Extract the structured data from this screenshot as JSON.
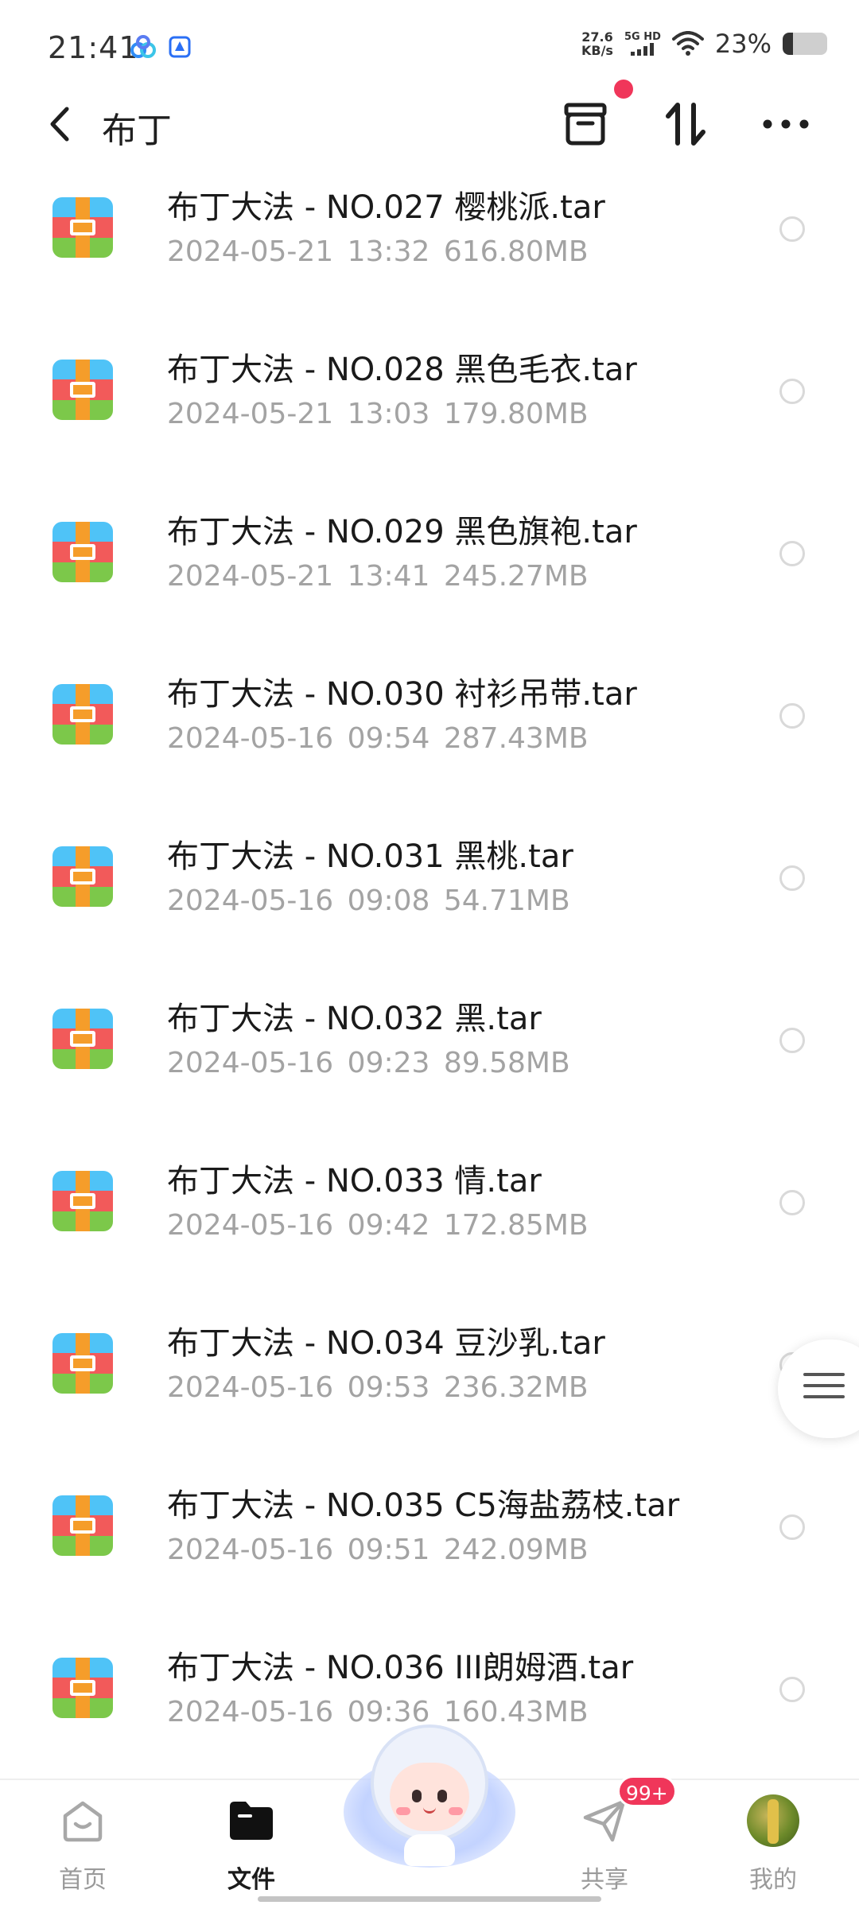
{
  "status_bar": {
    "time": "21:41",
    "net_speed_value": "27.6",
    "net_speed_unit": "KB/s",
    "network_label_top": "5G HD",
    "battery_percent": "23%",
    "battery_level": 0.23
  },
  "header": {
    "title": "布丁",
    "notification_dot": true
  },
  "files": [
    {
      "name": "布丁大法 - NO.027 樱桃派.tar",
      "date": "2024-05-21",
      "time": "13:32",
      "size": "616.80MB"
    },
    {
      "name": "布丁大法 - NO.028 黑色毛衣.tar",
      "date": "2024-05-21",
      "time": "13:03",
      "size": "179.80MB"
    },
    {
      "name": "布丁大法 - NO.029 黑色旗袍.tar",
      "date": "2024-05-21",
      "time": "13:41",
      "size": "245.27MB"
    },
    {
      "name": "布丁大法 - NO.030 衬衫吊带.tar",
      "date": "2024-05-16",
      "time": "09:54",
      "size": "287.43MB"
    },
    {
      "name": "布丁大法 - NO.031 黑桃.tar",
      "date": "2024-05-16",
      "time": "09:08",
      "size": "54.71MB"
    },
    {
      "name": "布丁大法 - NO.032 黑.tar",
      "date": "2024-05-16",
      "time": "09:23",
      "size": "89.58MB"
    },
    {
      "name": "布丁大法 - NO.033 情.tar",
      "date": "2024-05-16",
      "time": "09:42",
      "size": "172.85MB"
    },
    {
      "name": "布丁大法 - NO.034 豆沙乳.tar",
      "date": "2024-05-16",
      "time": "09:53",
      "size": "236.32MB"
    },
    {
      "name": "布丁大法 - NO.035 C5海盐荔枝.tar",
      "date": "2024-05-16",
      "time": "09:51",
      "size": "242.09MB"
    },
    {
      "name": "布丁大法 - NO.036 III朗姆酒.tar",
      "date": "2024-05-16",
      "time": "09:36",
      "size": "160.43MB"
    }
  ],
  "bottom_nav": {
    "items": [
      {
        "label": "首页",
        "icon": "home-icon",
        "active": false
      },
      {
        "label": "文件",
        "icon": "folder-icon",
        "active": true
      },
      {
        "label": "共享",
        "icon": "share-icon",
        "active": false,
        "badge": "99+"
      },
      {
        "label": "我的",
        "icon": "avatar",
        "active": false
      }
    ]
  },
  "colors": {
    "accent_red": "#f0365a",
    "meta_gray": "#a3a3a3",
    "archive_blue": "#4fc3f7",
    "archive_red": "#f25a5a",
    "archive_green": "#7cc84a",
    "archive_orange": "#f59d2a"
  }
}
